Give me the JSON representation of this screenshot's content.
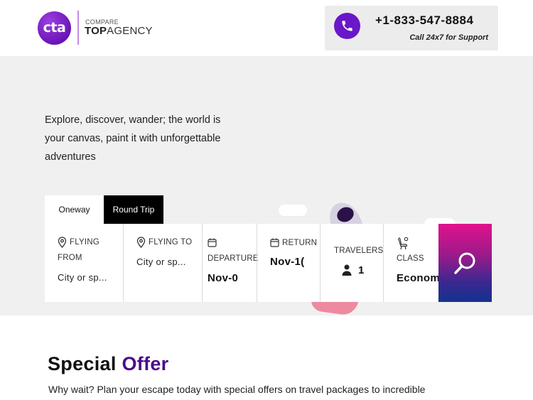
{
  "header": {
    "logo_mark": "cta",
    "logo_small": "COMPARE",
    "logo_brand_bold": "TOP",
    "logo_brand_rest": "AGENCY",
    "phone_number": "+1-833-547-8884",
    "phone_support": "Call 24x7 for Support",
    "phone_icon": "phone-icon"
  },
  "hero": {
    "tagline": "Explore, discover, wander; the world is your canvas, paint it with unforgettable adventures"
  },
  "search": {
    "tabs": [
      {
        "label": "Oneway",
        "active": true
      },
      {
        "label": "Round Trip",
        "active": false
      }
    ],
    "flying_from": {
      "label_line1": "FLYING",
      "label_line2": "FROM",
      "value": "City or sp...",
      "icon": "location-pin-icon"
    },
    "flying_to": {
      "label": "FLYING TO",
      "value": "City or sp...",
      "icon": "location-pin-icon"
    },
    "departure": {
      "label": "DEPARTURE",
      "value": "Nov-0",
      "icon": "calendar-icon"
    },
    "return": {
      "label": "RETURN",
      "value": "Nov-1(",
      "icon": "calendar-icon"
    },
    "travelers": {
      "label": "TRAVELERS",
      "value": "1",
      "icon": "person-icon"
    },
    "class": {
      "label": "CLASS",
      "value": "Econom",
      "icon": "seat-icon"
    },
    "search_icon": "search-icon"
  },
  "offer": {
    "title_part1": "Special",
    "title_part2": "Offer",
    "description": "Why wait? Plan your escape today with special offers on travel packages to incredible"
  },
  "colors": {
    "brand_purple": "#6a17c9",
    "accent_dark_purple": "#4a0d8a",
    "search_gradient_top": "#e0128d",
    "search_gradient_bottom": "#14328f",
    "hero_background": "#f0f0f0"
  }
}
